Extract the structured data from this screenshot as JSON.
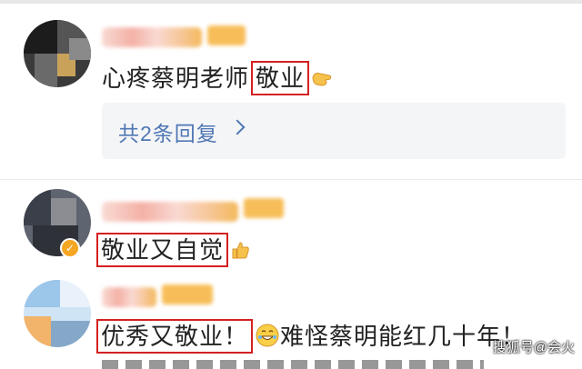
{
  "comments": [
    {
      "text_before": "心疼蔡明老师",
      "highlight": "敬业",
      "emoji": "hand-icon",
      "replies_label": "共2条回复"
    },
    {
      "highlight": "敬业又自觉",
      "emoji": "thumbs-icon"
    },
    {
      "highlight": "优秀又敬业！",
      "emoji": "grin-icon",
      "text_after": "难怪蔡明能红几十年！"
    }
  ],
  "watermark": "搜狐号@会火",
  "colors": {
    "highlight_border": "#d42020",
    "reply_link": "#5077b5",
    "reply_bg": "#f4f5f7"
  }
}
